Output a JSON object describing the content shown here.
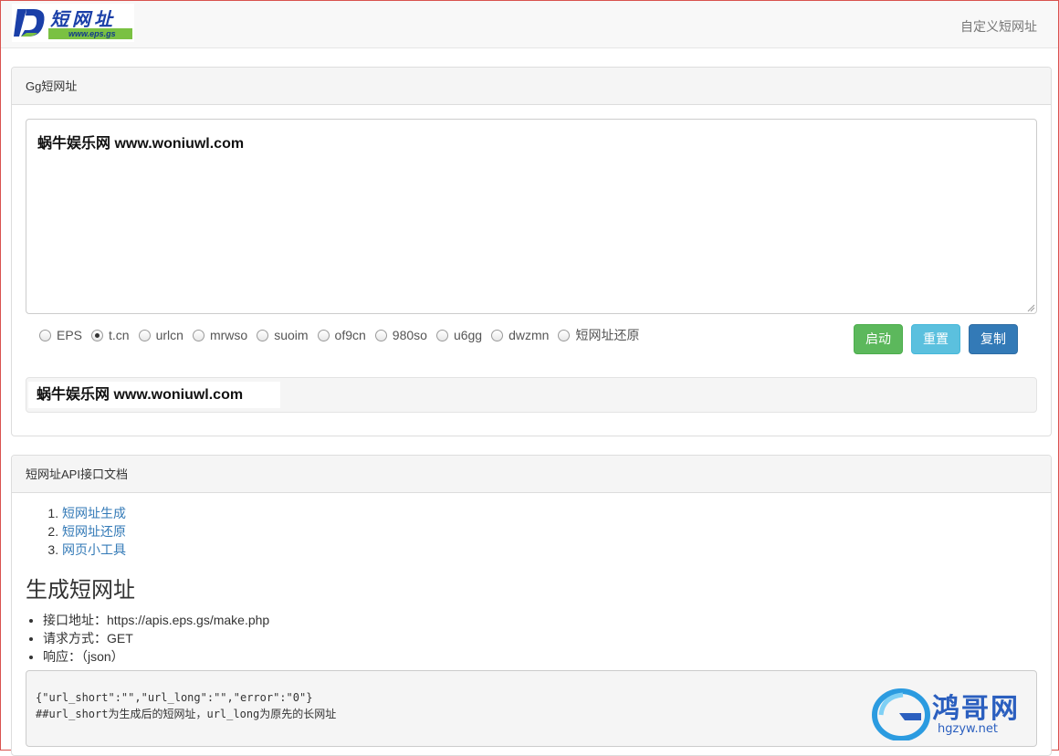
{
  "navbar": {
    "logo_text": "短网址",
    "logo_url": "www.eps.gs",
    "custom_link": "自定义短网址"
  },
  "main_panel": {
    "title": "Gg短网址",
    "textarea_value": "蜗牛娱乐网 www.woniuwl.com",
    "services": [
      {
        "label": "EPS",
        "checked": false
      },
      {
        "label": "t.cn",
        "checked": true
      },
      {
        "label": "urlcn",
        "checked": false
      },
      {
        "label": "mrwso",
        "checked": false
      },
      {
        "label": "suoim",
        "checked": false
      },
      {
        "label": "of9cn",
        "checked": false
      },
      {
        "label": "980so",
        "checked": false
      },
      {
        "label": "u6gg",
        "checked": false
      },
      {
        "label": "dwzmn",
        "checked": false
      },
      {
        "label": "短网址还原",
        "checked": false
      }
    ],
    "buttons": {
      "start": "启动",
      "reset": "重置",
      "copy": "复制"
    },
    "result": "蜗牛娱乐网 www.woniuwl.com"
  },
  "doc_panel": {
    "title": "短网址API接口文档",
    "toc": [
      "短网址生成",
      "短网址还原",
      "网页小工具"
    ],
    "section_title": "生成短网址",
    "specs": [
      "接口地址：https://apis.eps.gs/make.php",
      "请求方式：GET",
      "响应：（json）"
    ],
    "code_line1": "{\"url_short\":\"\",\"url_long\":\"\",\"error\":\"0\"}",
    "code_line2": "##url_short为生成后的短网址，url_long为原先的长网址"
  },
  "watermark": {
    "text": "鸿哥网",
    "url": "hgzyw.net"
  },
  "colors": {
    "success": "#5cb85c",
    "info": "#5bc0de",
    "primary": "#337ab7",
    "logo_blue": "#1a3fa8",
    "logo_green": "#7ac142"
  }
}
